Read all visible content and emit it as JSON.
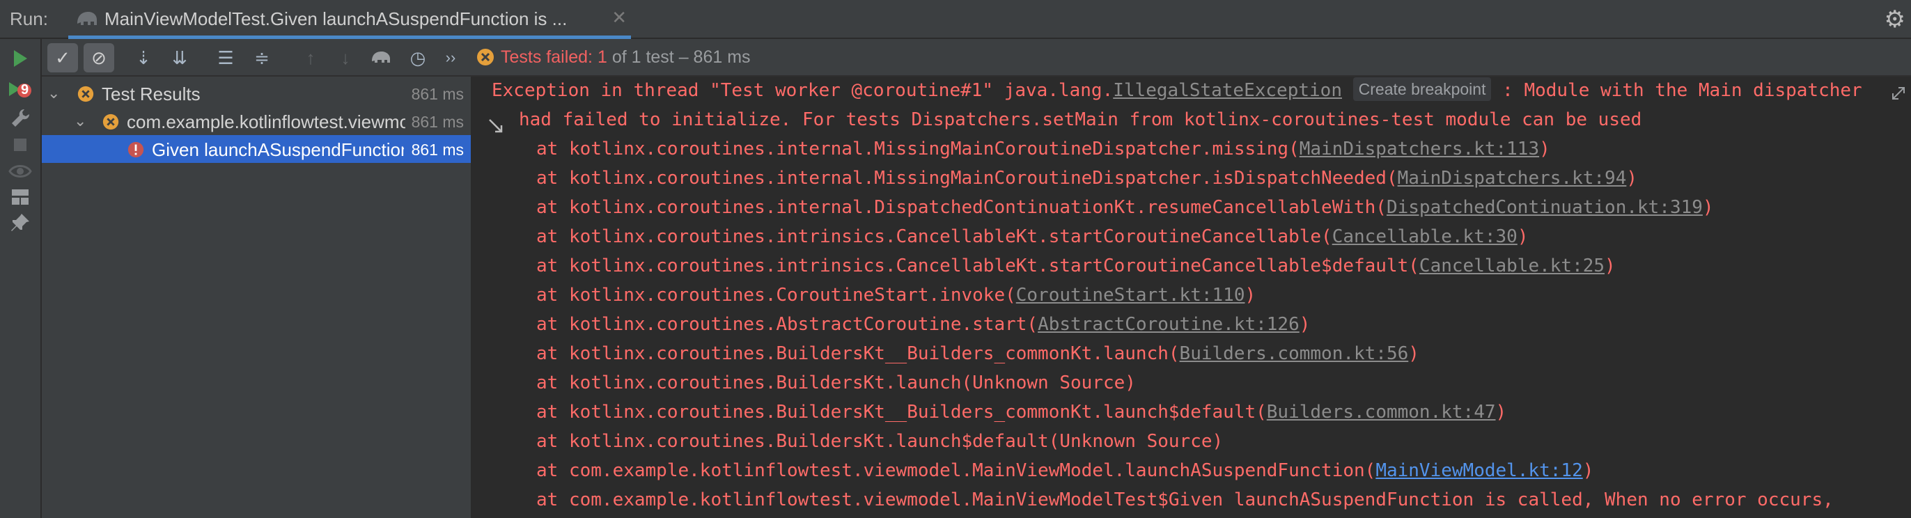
{
  "run_bar": {
    "label": "Run:",
    "tab_title": "MainViewModelTest.Given launchASuspendFunction is ...",
    "close_glyph": "✕",
    "settings_glyph": "⚙"
  },
  "left_strip": {
    "buttons": [
      "run-icon",
      "rerun-failed-icon",
      "wrench-icon",
      "stop-icon",
      "eye-icon",
      "layout-icon",
      "pin-icon"
    ],
    "rerun_badge": "9"
  },
  "toolbar": {
    "buttons": [
      "show-passed-icon",
      "show-ignored-icon",
      "sort-alpha-icon",
      "sort-duration-icon",
      "expand-all-icon",
      "collapse-all-icon",
      "prev-failed-icon",
      "next-failed-icon",
      "import-tests-icon",
      "history-icon"
    ],
    "more_glyph": "››",
    "status_failed": "Tests failed: 1",
    "status_rest": "of 1 test – 861 ms"
  },
  "tree": {
    "rows": [
      {
        "label": "Test Results",
        "duration": "861 ms"
      },
      {
        "label": "com.example.kotlinflowtest.viewmodel.MainViewModelTest",
        "duration": "861 ms"
      },
      {
        "label": "Given launchASuspendFunction is called, When no error occurs, Then it should complete",
        "duration": "861 ms"
      }
    ]
  },
  "console": {
    "line1": {
      "pre": "Exception in thread \"Test worker @coroutine#1\" java.lang.",
      "link": "IllegalStateException",
      "hint": "Create breakpoint",
      "post": " : Module with the Main dispatcher"
    },
    "line2": "had failed to initialize. For tests Dispatchers.setMain from kotlinx-coroutines-test module can be used",
    "trace": [
      {
        "pre": "at kotlinx.coroutines.internal.MissingMainCoroutineDispatcher.missing(",
        "link": "MainDispatchers.kt:113",
        "post": ")"
      },
      {
        "pre": "at kotlinx.coroutines.internal.MissingMainCoroutineDispatcher.isDispatchNeeded(",
        "link": "MainDispatchers.kt:94",
        "post": ")"
      },
      {
        "pre": "at kotlinx.coroutines.internal.DispatchedContinuationKt.resumeCancellableWith(",
        "link": "DispatchedContinuation.kt:319",
        "post": ")"
      },
      {
        "pre": "at kotlinx.coroutines.intrinsics.CancellableKt.startCoroutineCancellable(",
        "link": "Cancellable.kt:30",
        "post": ")"
      },
      {
        "pre": "at kotlinx.coroutines.intrinsics.CancellableKt.startCoroutineCancellable$default(",
        "link": "Cancellable.kt:25",
        "post": ")"
      },
      {
        "pre": "at kotlinx.coroutines.CoroutineStart.invoke(",
        "link": "CoroutineStart.kt:110",
        "post": ")"
      },
      {
        "pre": "at kotlinx.coroutines.AbstractCoroutine.start(",
        "link": "AbstractCoroutine.kt:126",
        "post": ")"
      },
      {
        "pre": "at kotlinx.coroutines.BuildersKt__Builders_commonKt.launch(",
        "link": "Builders.common.kt:56",
        "post": ")"
      },
      {
        "pre": "at kotlinx.coroutines.BuildersKt.launch(Unknown Source)",
        "link": "",
        "post": ""
      },
      {
        "pre": "at kotlinx.coroutines.BuildersKt__Builders_commonKt.launch$default(",
        "link": "Builders.common.kt:47",
        "post": ")"
      },
      {
        "pre": "at kotlinx.coroutines.BuildersKt.launch$default(Unknown Source)",
        "link": "",
        "post": ""
      },
      {
        "pre": "at com.example.kotlinflowtest.viewmodel.MainViewModel.launchASuspendFunction(",
        "link": "MainViewModel.kt:12",
        "post": ")"
      },
      {
        "pre": "at com.example.kotlinflowtest.viewmodel.MainViewModelTest$Given launchASuspendFunction is called, When no error occurs,",
        "link": "",
        "post": ""
      }
    ]
  },
  "colors": {
    "error_red": "#ff6b68",
    "selection_blue": "#2f65ca",
    "tab_underline": "#4a88c7",
    "project_link_blue": "#5394ec",
    "failed_orange": "#e5a03b"
  }
}
